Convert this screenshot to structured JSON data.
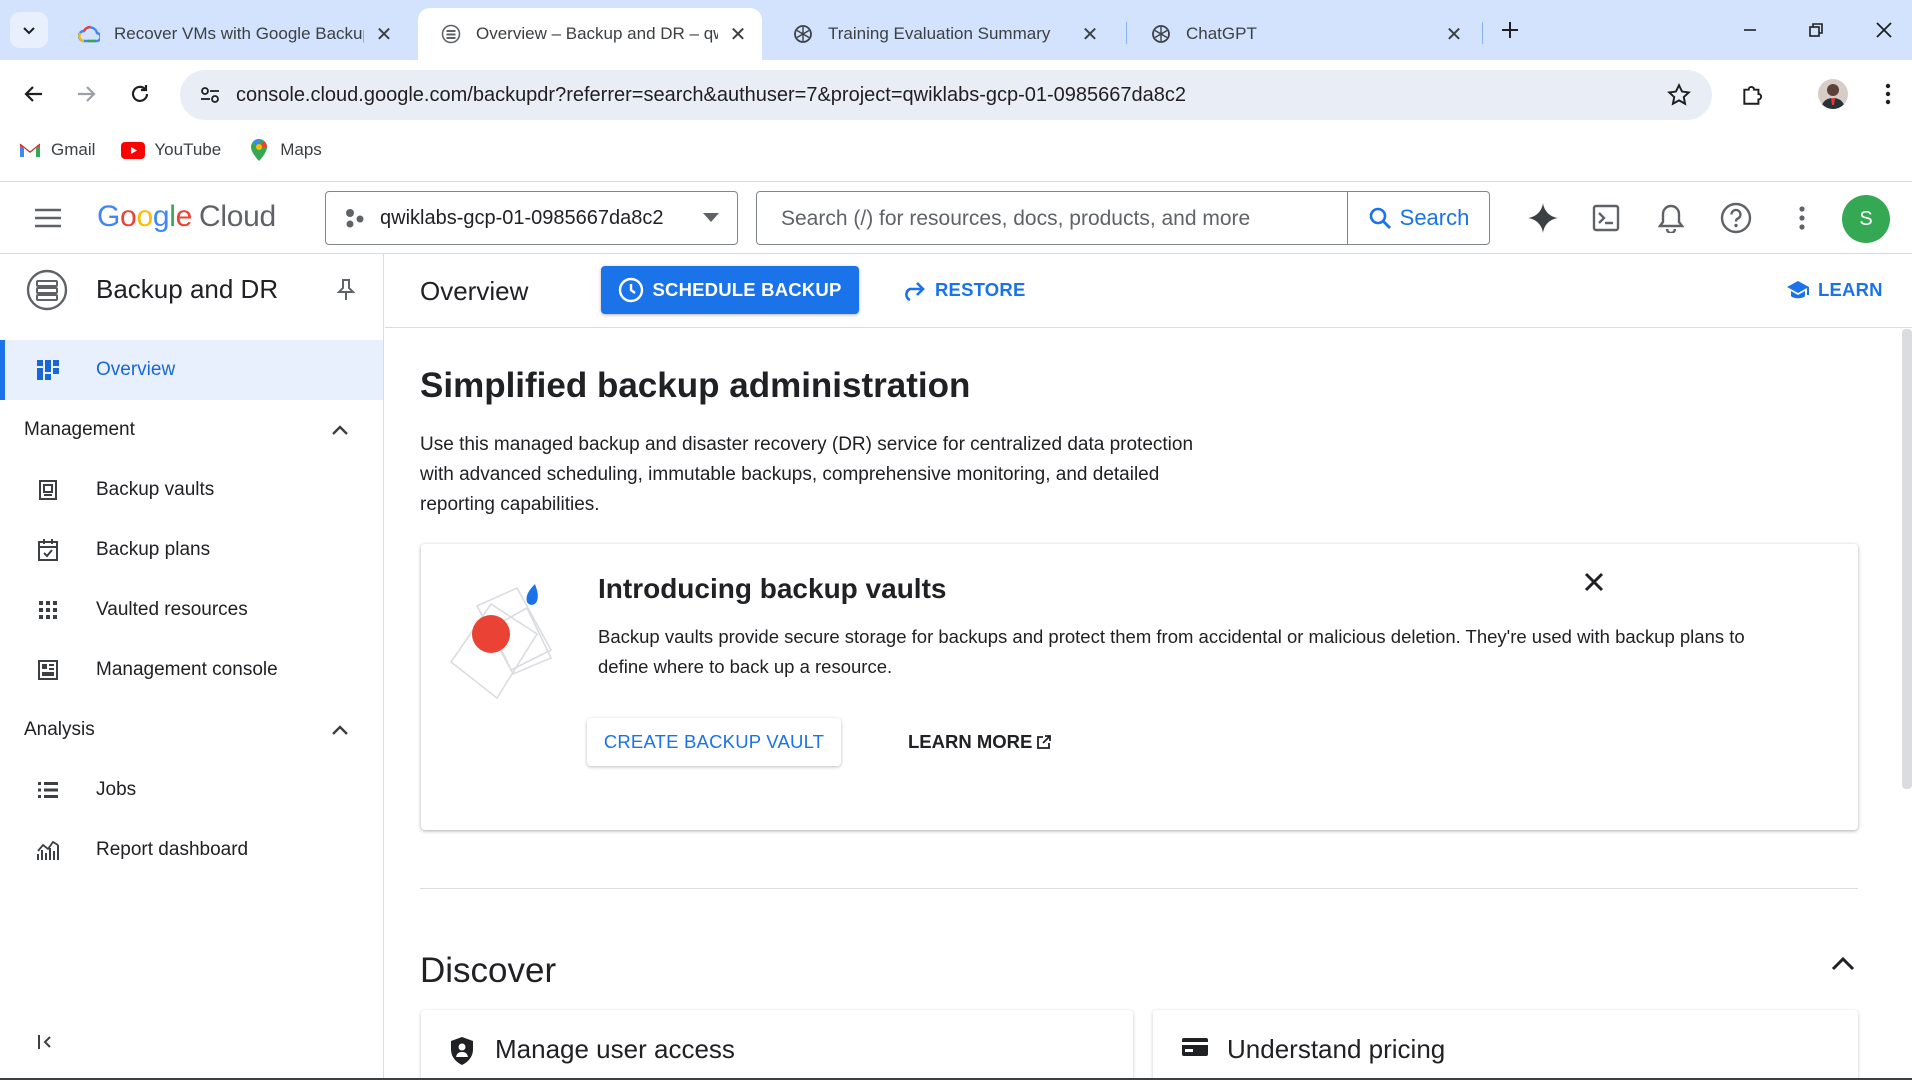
{
  "browser": {
    "tabs": [
      {
        "title": "Recover VMs with Google Backup",
        "active": false
      },
      {
        "title": "Overview – Backup and DR – qwiklabs",
        "active": true
      },
      {
        "title": "Training Evaluation Summary",
        "active": false
      },
      {
        "title": "ChatGPT",
        "active": false
      }
    ],
    "url": "console.cloud.google.com/backupdr?referrer=search&authuser=7&project=qwiklabs-gcp-01-0985667da8c2",
    "bookmarks": [
      {
        "label": "Gmail",
        "icon": "gmail-icon"
      },
      {
        "label": "YouTube",
        "icon": "youtube-icon"
      },
      {
        "label": "Maps",
        "icon": "maps-icon"
      }
    ]
  },
  "gcp": {
    "logo_google": "Google",
    "logo_cloud": "Cloud",
    "project": "qwiklabs-gcp-01-0985667da8c2",
    "search_placeholder": "Search (/) for resources, docs, products, and more",
    "search_button": "Search",
    "user_initial": "S"
  },
  "sidebar": {
    "product": "Backup and DR",
    "overview": "Overview",
    "sections": [
      {
        "label": "Management",
        "items": [
          "Backup vaults",
          "Backup plans",
          "Vaulted resources",
          "Management console"
        ]
      },
      {
        "label": "Analysis",
        "items": [
          "Jobs",
          "Report dashboard"
        ]
      }
    ]
  },
  "main": {
    "page_title": "Overview",
    "schedule_backup": "SCHEDULE BACKUP",
    "restore": "RESTORE",
    "learn": "LEARN",
    "heading": "Simplified backup administration",
    "description": "Use this managed backup and disaster recovery (DR) service for centralized data protection with advanced scheduling, immutable backups, comprehensive monitoring, and detailed reporting capabilities.",
    "card": {
      "title": "Introducing backup vaults",
      "body": "Backup vaults provide secure storage for backups and protect them from accidental or malicious deletion. They're used with backup plans to define where to back up a resource.",
      "primary": "CREATE BACKUP VAULT",
      "secondary": "LEARN MORE"
    },
    "discover": {
      "title": "Discover",
      "cards": [
        "Manage user access",
        "Understand pricing"
      ]
    }
  },
  "colors": {
    "accent": "#1a73e8",
    "tabbar": "#d3e3fd",
    "active_nav_bg": "#e8f0fe",
    "avatar": "#34a853"
  }
}
